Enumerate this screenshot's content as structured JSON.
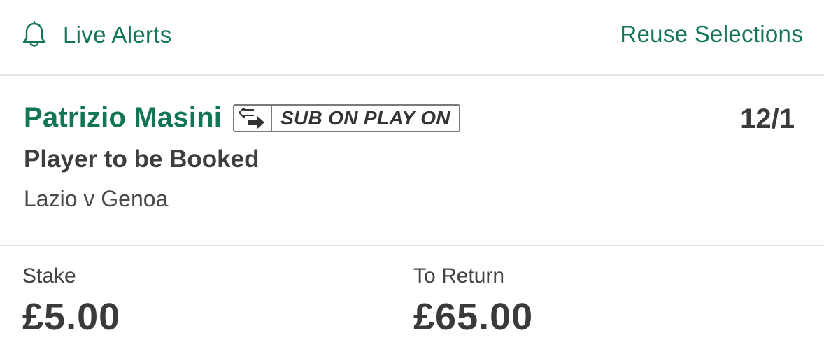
{
  "header": {
    "live_alerts_label": "Live Alerts",
    "live_alerts_icon": "bell-icon",
    "reuse_selections_label": "Reuse Selections"
  },
  "selection": {
    "name": "Patrizio Masini",
    "badge_icon": "substitution-arrows-icon",
    "badge_label": "SUB ON PLAY ON",
    "odds": "12/1",
    "market": "Player to be Booked",
    "event": "Lazio v Genoa"
  },
  "betting": {
    "stake_label": "Stake",
    "stake_value": "£5.00",
    "return_label": "To Return",
    "return_value": "£65.00"
  },
  "colors": {
    "brand_green": "#137652",
    "text_dark": "#3a3a3a",
    "divider": "#e4e4e4"
  }
}
